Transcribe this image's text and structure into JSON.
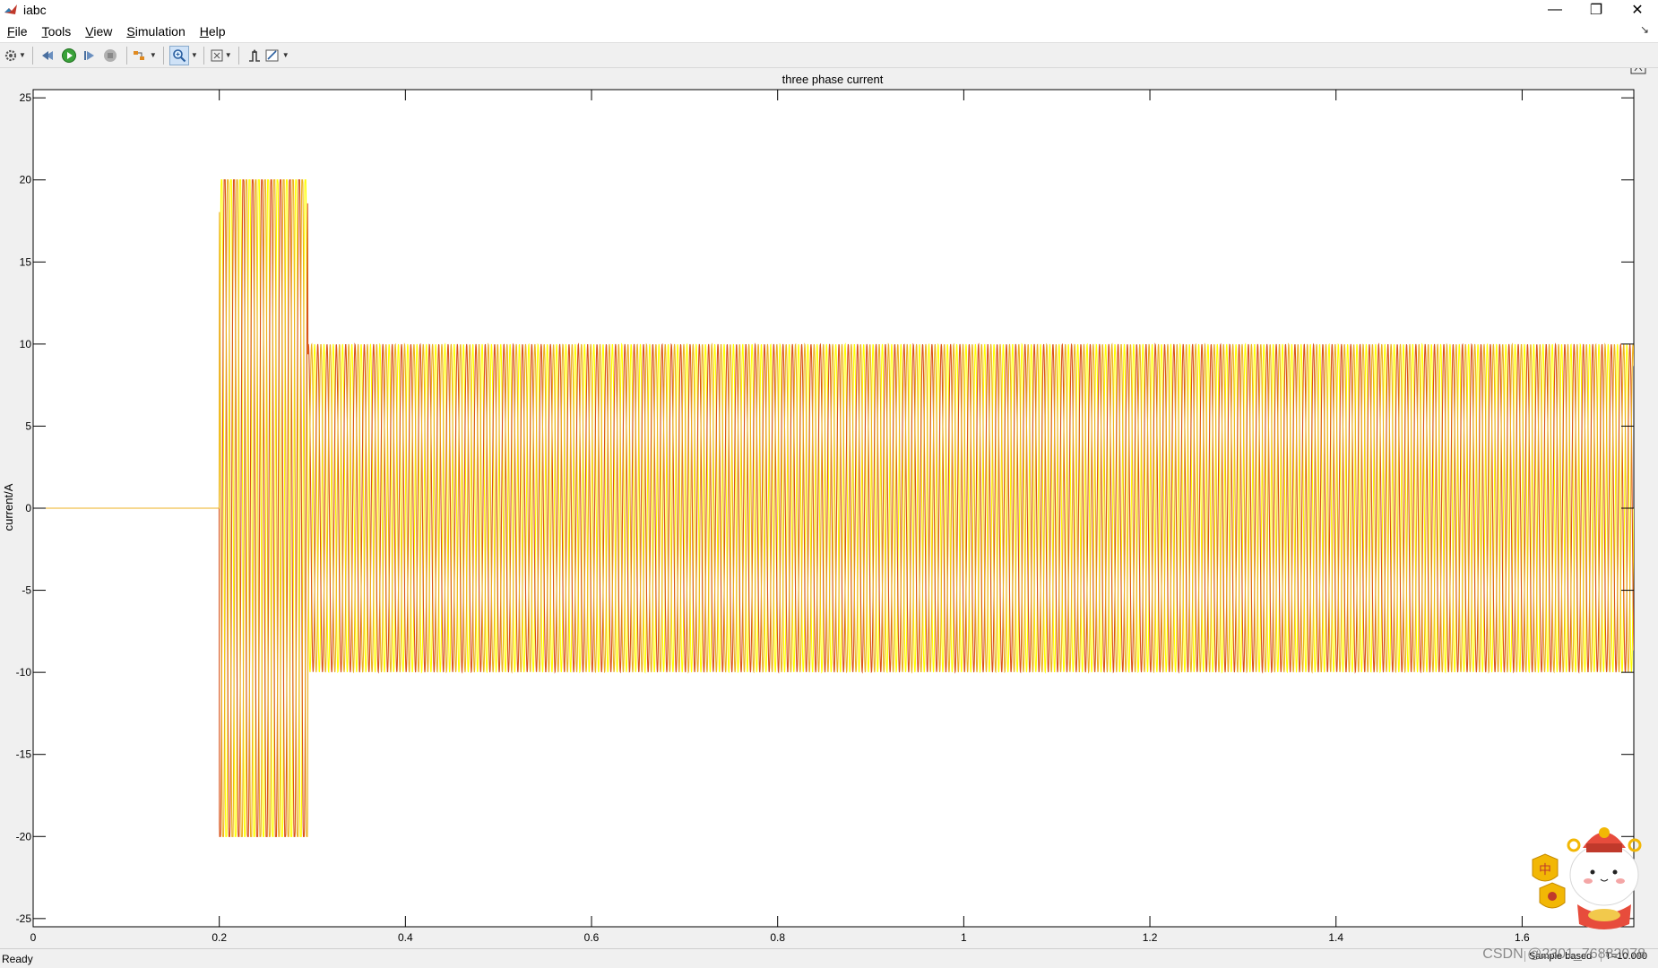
{
  "window": {
    "title": "iabc",
    "controls": {
      "minimize": "—",
      "restore": "❐",
      "close": "✕"
    }
  },
  "menu": [
    {
      "label": "File",
      "key": "F",
      "rest": "ile"
    },
    {
      "label": "Tools",
      "key": "T",
      "rest": "ools"
    },
    {
      "label": "View",
      "key": "V",
      "rest": "iew"
    },
    {
      "label": "Simulation",
      "key": "S",
      "rest": "imulation"
    },
    {
      "label": "Help",
      "key": "H",
      "rest": "elp"
    }
  ],
  "toolbar": {
    "icons": [
      "settings-icon",
      "step-back-icon",
      "run-icon",
      "step-forward-icon",
      "stop-icon",
      "highlight-icon",
      "zoom-icon",
      "fit-to-view-icon",
      "triggers-icon",
      "measurements-icon"
    ]
  },
  "chart_data": {
    "type": "line",
    "title": "three phase current",
    "xlabel": "",
    "ylabel": "current/A",
    "xlim": [
      0,
      1.72
    ],
    "ylim": [
      -25.5,
      25.5
    ],
    "xticks": [
      0,
      0.2,
      0.4,
      0.6,
      0.8,
      1,
      1.2,
      1.4,
      1.6
    ],
    "xtick_labels": [
      "0",
      "0.2",
      "0.4",
      "0.6",
      "0.8",
      "1",
      "1.2",
      "1.4",
      "1.6"
    ],
    "yticks": [
      25,
      20,
      15,
      10,
      5,
      0,
      -5,
      -10,
      -15,
      -20,
      -25
    ],
    "ytick_labels": [
      "25",
      "20",
      "15",
      "10",
      "5",
      "0",
      "-5",
      "-10",
      "-15",
      "-20",
      "-25"
    ],
    "grid": false,
    "series": [
      {
        "color": "#ffff00",
        "values_description": ""
      },
      {
        "color": "#d95319",
        "values_description": ""
      },
      {
        "color": "#edb120",
        "values_description": ""
      }
    ],
    "segments": [
      {
        "x_start": 0,
        "x_end": 0.2,
        "amplitude": 0
      },
      {
        "x_start": 0.2,
        "x_end": 0.295,
        "amplitude": 20
      },
      {
        "x_start": 0.295,
        "x_end": 1.72,
        "amplitude": 10
      }
    ],
    "frequency_hz": 100
  },
  "status": {
    "text": "Ready",
    "sample": "Sample based",
    "time": "T=10.000"
  },
  "watermark": "CSDN @2301_76882078"
}
